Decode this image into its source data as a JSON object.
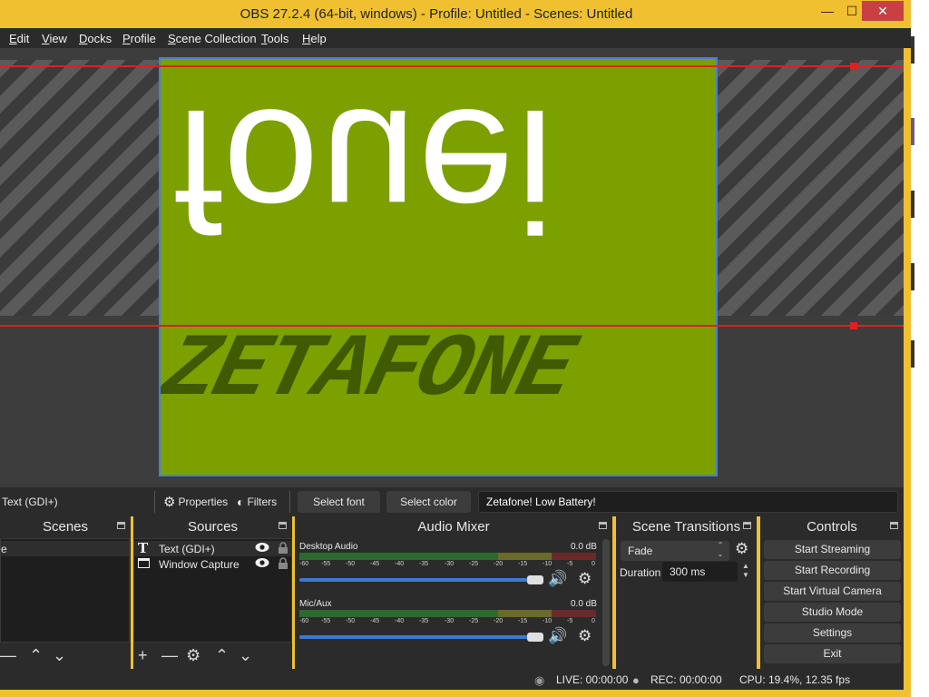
{
  "window": {
    "title": "OBS 27.2.4 (64-bit, windows) - Profile: Untitled - Scenes: Untitled",
    "minimize": "—",
    "maximize": "☐",
    "close": "✕"
  },
  "menu": [
    "Edit",
    "View",
    "Docks",
    "Profile",
    "Scene Collection",
    "Tools",
    "Help"
  ],
  "preview": {
    "flipped_text": "fouei",
    "brand_text": "ZETAFONE"
  },
  "source_toolbar": {
    "selected_source": "Text (GDI+)",
    "properties": "Properties",
    "filters": "Filters",
    "select_font": "Select font",
    "select_color": "Select color",
    "text_value": "Zetafone! Low Battery!"
  },
  "scenes": {
    "title": "Scenes",
    "items": [
      "e"
    ]
  },
  "sources": {
    "title": "Sources",
    "items": [
      {
        "label": "Text (GDI+)",
        "icon": "text-icon"
      },
      {
        "label": "Window Capture",
        "icon": "window-icon"
      }
    ]
  },
  "mixer": {
    "title": "Audio Mixer",
    "ticks": [
      "-60",
      "-55",
      "-50",
      "-45",
      "-40",
      "-35",
      "-30",
      "-25",
      "-20",
      "-15",
      "-10",
      "-5",
      "0"
    ],
    "channels": [
      {
        "name": "Desktop Audio",
        "level": "0.0 dB",
        "volume": 0.95
      },
      {
        "name": "Mic/Aux",
        "level": "0.0 dB",
        "volume": 0.95
      }
    ]
  },
  "transitions": {
    "title": "Scene Transitions",
    "selected": "Fade",
    "duration_label": "Duration",
    "duration_value": "300 ms"
  },
  "controls": {
    "title": "Controls",
    "buttons": [
      "Start Streaming",
      "Start Recording",
      "Start Virtual Camera",
      "Studio Mode",
      "Settings",
      "Exit"
    ]
  },
  "status": {
    "live": "LIVE: 00:00:00",
    "rec": "REC: 00:00:00",
    "cpu": "CPU: 19.4%, 12.35 fps"
  },
  "colors": {
    "canvas": "#7ba000",
    "accent": "#3a7bd5",
    "frame": "#f0c030"
  }
}
